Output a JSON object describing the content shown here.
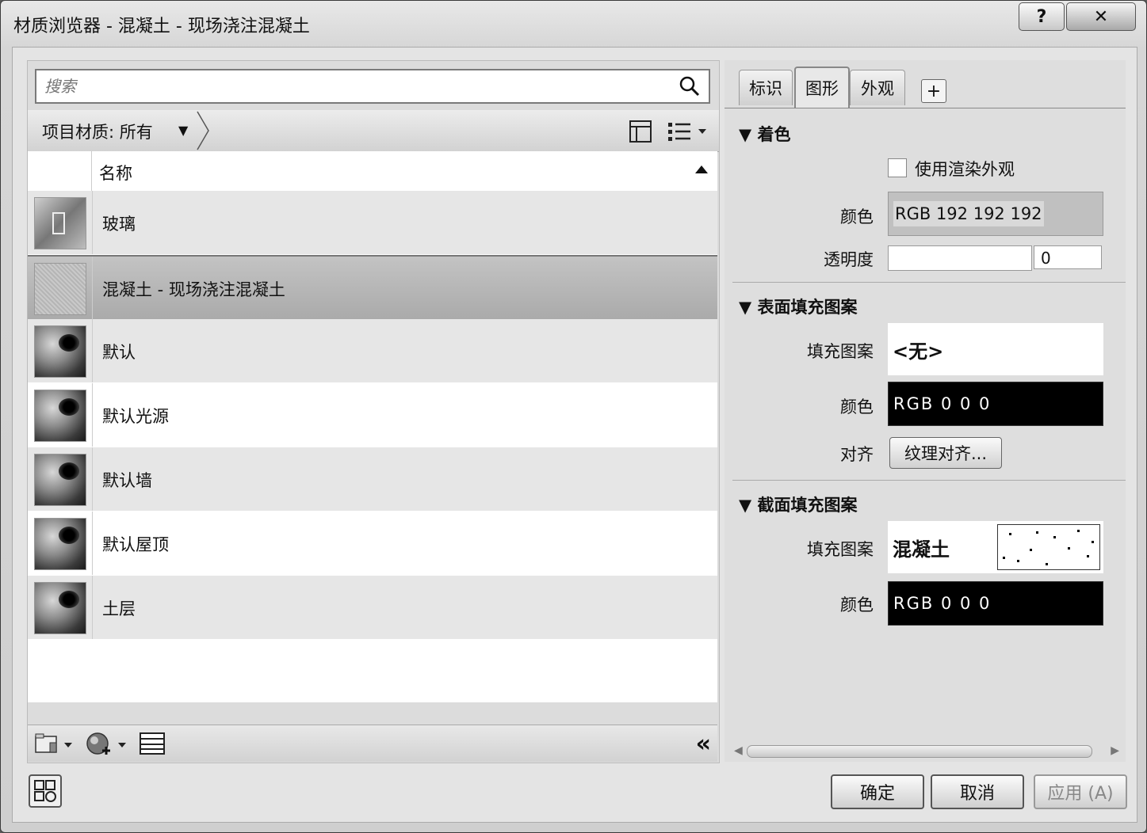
{
  "window": {
    "title": "材质浏览器 - 混凝土 - 现场浇注混凝土",
    "help_label": "?",
    "close_label": "✕"
  },
  "search": {
    "placeholder": "搜索"
  },
  "filter": {
    "label": "项目材质: 所有"
  },
  "table": {
    "header_name": "名称",
    "rows": [
      {
        "name": "玻璃",
        "thumb": "glass-thumbnail",
        "style": "alt"
      },
      {
        "name": "混凝土 - 现场浇注混凝土",
        "thumb": "concrete-thumbnail",
        "style": "selected"
      },
      {
        "name": "默认",
        "thumb": "sphere-thumbnail",
        "style": "alt"
      },
      {
        "name": "默认光源",
        "thumb": "sphere-thumbnail",
        "style": "plain"
      },
      {
        "name": "默认墙",
        "thumb": "sphere-thumbnail",
        "style": "alt"
      },
      {
        "name": "默认屋顶",
        "thumb": "sphere-thumbnail",
        "style": "plain"
      },
      {
        "name": "土层",
        "thumb": "sphere-thumbnail",
        "style": "alt"
      }
    ]
  },
  "tabs": [
    {
      "label": "标识",
      "active": false
    },
    {
      "label": "图形",
      "active": true
    },
    {
      "label": "外观",
      "active": false
    }
  ],
  "tab_add_label": "+",
  "shading": {
    "heading": "着色",
    "use_render_label": "使用渲染外观",
    "color_label": "颜色",
    "color_value": "RGB 192 192 192",
    "transparency_label": "透明度",
    "transparency_value": "0"
  },
  "surface": {
    "heading": "表面填充图案",
    "pattern_label": "填充图案",
    "pattern_value": "<无>",
    "color_label": "颜色",
    "color_value": "RGB 0 0 0",
    "align_label": "对齐",
    "align_button": "纹理对齐..."
  },
  "cut": {
    "heading": "截面填充图案",
    "pattern_label": "填充图案",
    "pattern_value": "混凝土",
    "color_label": "颜色",
    "color_value": "RGB 0 0 0"
  },
  "footer": {
    "ok": "确定",
    "cancel": "取消",
    "apply": "应用 (A)"
  },
  "colors": {
    "swatch_gray": "#c0c0c0",
    "swatch_black": "#000000"
  }
}
